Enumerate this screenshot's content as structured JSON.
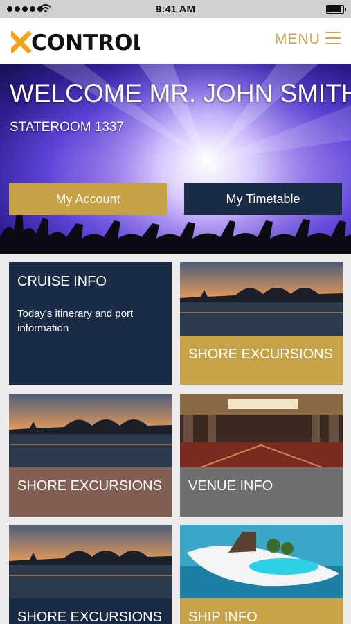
{
  "status_bar": {
    "time": "9:41 AM"
  },
  "header": {
    "logo_x": "x",
    "logo_text": "CONTROL",
    "menu_label": "MENU"
  },
  "colors": {
    "gold": "#c6a346",
    "navy": "#1a2b45",
    "rose": "#825f52",
    "grey": "#6f6f6f"
  },
  "hero": {
    "title": "WELCOME MR. JOHN SMITH",
    "stateroom": "STATEROOM 1337",
    "account_button": "My Account",
    "timetable_button": "My Timetable"
  },
  "tiles": [
    {
      "label": "CRUISE INFO",
      "description": "Today's itinerary and port information"
    },
    {
      "label": "SHORE EXCURSIONS"
    },
    {
      "label": "SHORE EXCURSIONS"
    },
    {
      "label": "VENUE INFO"
    },
    {
      "label": "SHORE EXCURSIONS"
    },
    {
      "label": "SHIP INFO"
    }
  ]
}
